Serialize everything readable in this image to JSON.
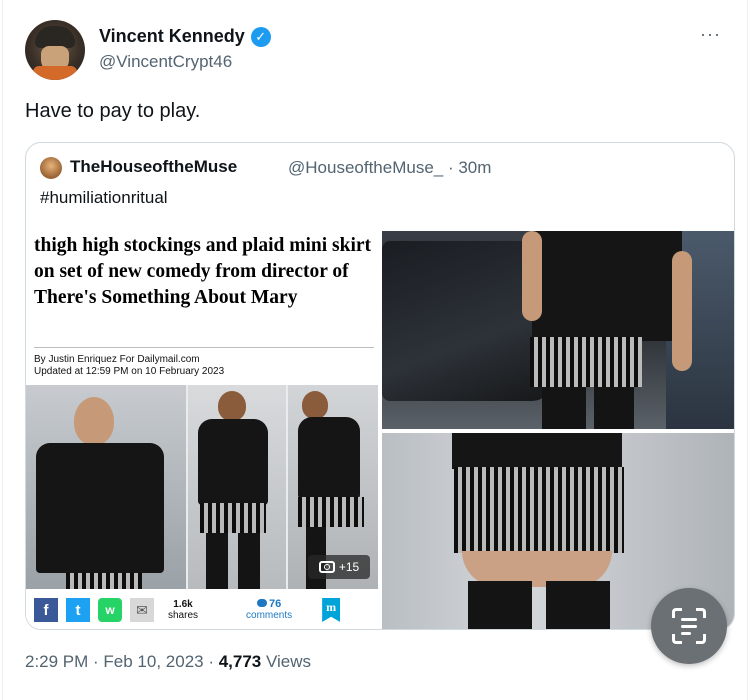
{
  "tweet": {
    "author_name": "Vincent Kennedy",
    "author_handle": "@VincentCrypt46",
    "more_label": "···",
    "text": "Have to pay to play.",
    "timestamp": "2:29 PM · Feb 10, 2023 · ",
    "views_count": "4,773",
    "views_label": " Views"
  },
  "quoted": {
    "author_name": "TheHouseoftheMuse",
    "author_handle_time": "@HouseoftheMuse_ · 30m",
    "hashtag": "#humiliationritual",
    "article": {
      "headline": "thigh high stockings and plaid mini skirt on set of new comedy from director of There's Something About Mary",
      "byline": "By Justin Enriquez For Dailymail.com",
      "updated": "Updated at 12:59 PM on 10 February 2023",
      "photo_count": "+15",
      "share_icons": [
        "f",
        "t",
        "w",
        "✉"
      ],
      "shares_count": "1.6k",
      "shares_label": "shares",
      "comments_count": "76",
      "comments_label": "comments",
      "logo_letter": "m"
    }
  },
  "colors": {
    "accent": "#1d9bf0",
    "secondary_text": "#536471",
    "border": "#cfd9de"
  }
}
